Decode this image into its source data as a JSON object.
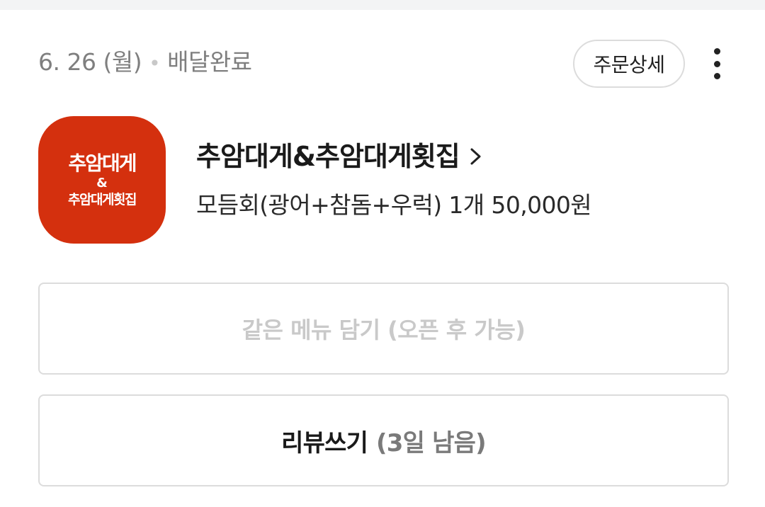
{
  "order": {
    "date": "6. 26 (월)",
    "separator": "•",
    "status": "배달완료",
    "detail_button": "주문상세",
    "more_icon": "more-vertical-icon"
  },
  "store": {
    "logo_line1": "추암대게",
    "logo_line2": "&",
    "logo_line3": "추암대게횟집",
    "logo_color": "#d4300e",
    "name": "추암대게&추암대게횟집",
    "chevron_icon": "chevron-right-icon",
    "menu_summary": "모듬회(광어+참돔+우럭) 1개 50,000원"
  },
  "actions": {
    "reorder_label": "같은 메뉴 담기 (오픈 후 가능)",
    "review_label": "리뷰쓰기",
    "review_remaining": "(3일 남음)"
  }
}
